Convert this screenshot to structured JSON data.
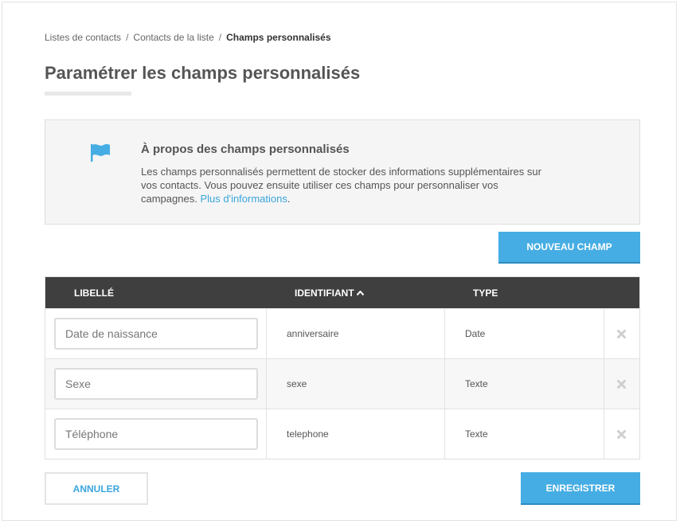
{
  "breadcrumb": {
    "items": [
      "Listes de contacts",
      "Contacts de la liste"
    ],
    "current": "Champs personnalisés",
    "separator": "/"
  },
  "page": {
    "title": "Paramétrer les champs personnalisés"
  },
  "info": {
    "icon": "flag-icon",
    "title": "À propos des champs personnalisés",
    "text": "Les champs personnalisés permettent de stocker des informations supplémentaires sur vos contacts. Vous pouvez ensuite utiliser ces champs pour personnaliser vos campagnes.",
    "link": "Plus d'informations",
    "suffix": "."
  },
  "actions": {
    "new_field": "NOUVEAU CHAMP",
    "cancel": "ANNULER",
    "save": "ENREGISTRER"
  },
  "table": {
    "headers": {
      "label": "LIBELLÉ",
      "identifier": "IDENTIFIANT",
      "type": "TYPE"
    },
    "sort_icon": "sort-ascending-icon",
    "rows": [
      {
        "label": "Date de naissance",
        "identifier": "anniversaire",
        "type": "Date"
      },
      {
        "label": "Sexe",
        "identifier": "sexe",
        "type": "Texte"
      },
      {
        "label": "Téléphone",
        "identifier": "telephone",
        "type": "Texte"
      }
    ],
    "delete_icon": "close-icon"
  },
  "colors": {
    "accent": "#45ade3",
    "header_bg": "#3f3f3f",
    "link": "#3aa5dc"
  }
}
